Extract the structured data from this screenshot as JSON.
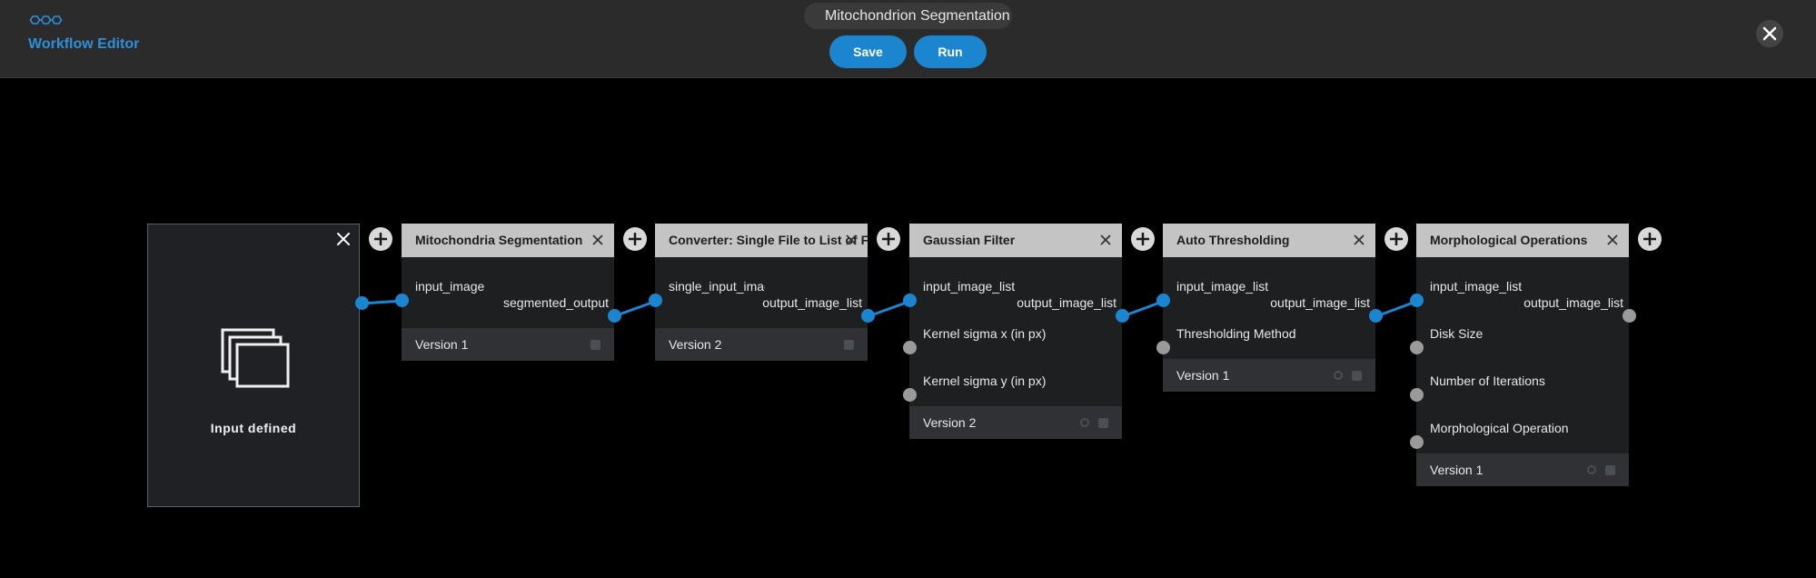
{
  "header": {
    "app_title": "Workflow Editor",
    "workflow_name": "Mitochondrion Segmentation",
    "save_label": "Save",
    "run_label": "Run"
  },
  "input_node": {
    "label": "Input defined"
  },
  "nodes": [
    {
      "title": "Mitochondria Segmentation",
      "inputs": [
        "input_image"
      ],
      "output": "segmented_output",
      "version": "Version 1"
    },
    {
      "title": "Converter: Single File to List of Files",
      "inputs": [
        "single_input_image"
      ],
      "output": "output_image_list",
      "version": "Version 2"
    },
    {
      "title": "Gaussian Filter",
      "inputs": [
        "input_image_list",
        "Kernel sigma x (in px)",
        "Kernel sigma y (in px)"
      ],
      "output": "output_image_list",
      "version": "Version 2"
    },
    {
      "title": "Auto Thresholding",
      "inputs": [
        "input_image_list",
        "Thresholding Method"
      ],
      "output": "output_image_list",
      "version": "Version 1"
    },
    {
      "title": "Morphological Operations",
      "inputs": [
        "input_image_list",
        "Disk Size",
        "Number of Iterations",
        "Morphological Operation"
      ],
      "output": "output_image_list",
      "version": "Version 1"
    }
  ],
  "colors": {
    "accent": "#1c85d0",
    "header_bg": "#2b2b2b",
    "canvas_bg": "#000000"
  }
}
